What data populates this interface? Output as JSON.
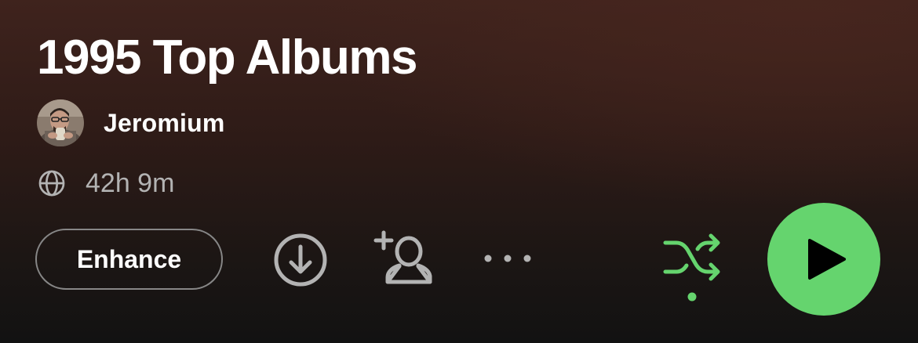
{
  "playlist": {
    "title": "1995 Top Albums",
    "owner": "Jeromium",
    "duration": "42h 9m"
  },
  "actions": {
    "enhance_label": "Enhance"
  },
  "icons": {
    "visibility": "globe-icon",
    "download": "download-icon",
    "add_collaborator": "add-user-icon",
    "more": "more-options-icon",
    "shuffle": "shuffle-icon",
    "play": "play-icon"
  },
  "colors": {
    "accent_green": "#65d46e",
    "background_top": "#3f231d",
    "background_bottom": "#121212",
    "muted_text": "#b3b3b3"
  },
  "state": {
    "shuffle_enabled": true
  }
}
